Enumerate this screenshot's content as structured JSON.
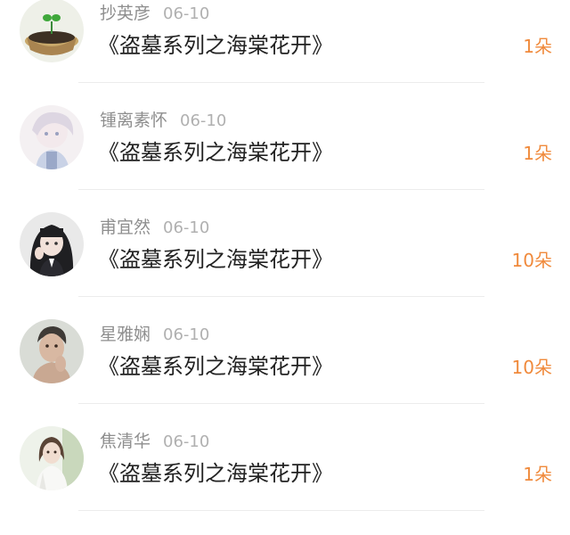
{
  "colors": {
    "name": "#8e8e8e",
    "date": "#b0b0b0",
    "title": "#222222",
    "count": "#f08a3c",
    "divider": "#ececec"
  },
  "list": {
    "items": [
      {
        "avatar": "avatar-photo-plant",
        "name": "抄英彦",
        "date": "06-10",
        "title": "《盗墓系列之海棠花开》",
        "count": "1朵"
      },
      {
        "avatar": "avatar-photo-anime-girl",
        "name": "锺离素怀",
        "date": "06-10",
        "title": "《盗墓系列之海棠花开》",
        "count": "1朵"
      },
      {
        "avatar": "avatar-photo-girl",
        "name": "甫宜然",
        "date": "06-10",
        "title": "《盗墓系列之海棠花开》",
        "count": "10朵"
      },
      {
        "avatar": "avatar-photo-man",
        "name": "星雅娴",
        "date": "06-10",
        "title": "《盗墓系列之海棠花开》",
        "count": "10朵"
      },
      {
        "avatar": "avatar-photo-woman",
        "name": "焦清华",
        "date": "06-10",
        "title": "《盗墓系列之海棠花开》",
        "count": "1朵"
      }
    ]
  }
}
